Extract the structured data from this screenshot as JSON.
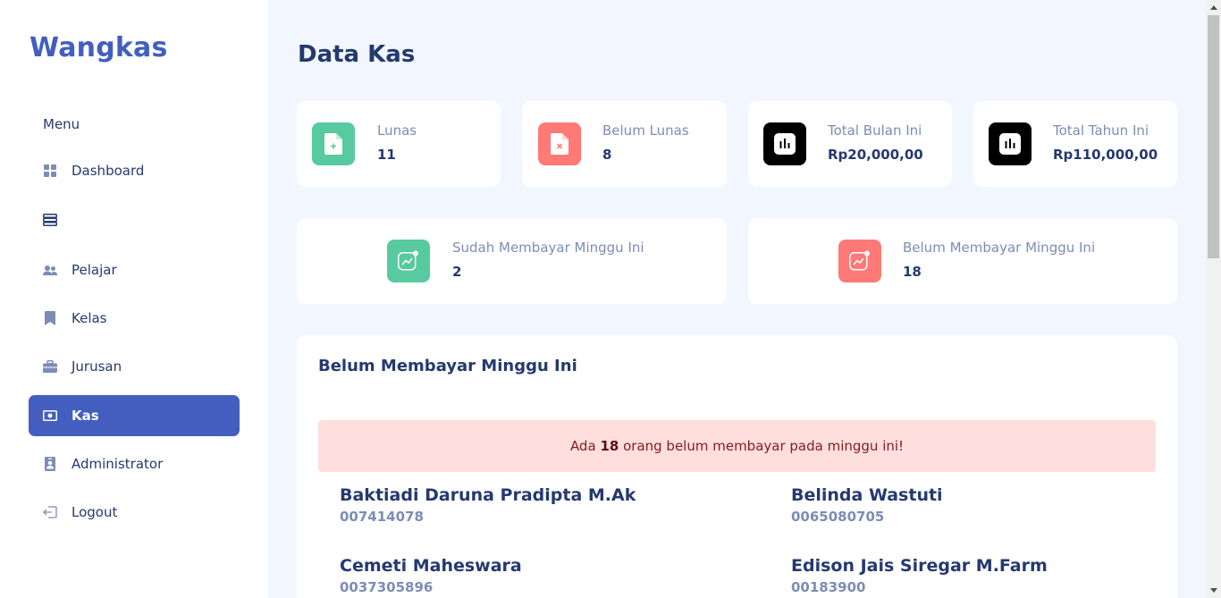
{
  "sidebar": {
    "brand": "Wangkas",
    "menu_title": "Menu",
    "items": [
      {
        "label": "Dashboard",
        "icon": "grid-icon"
      },
      {
        "label": "",
        "icon": "stack-icon"
      },
      {
        "label": "Pelajar",
        "icon": "people-icon"
      },
      {
        "label": "Kelas",
        "icon": "bookmark-icon"
      },
      {
        "label": "Jurusan",
        "icon": "briefcase-icon"
      },
      {
        "label": "Kas",
        "icon": "cash-icon",
        "active": true
      },
      {
        "label": "Administrator",
        "icon": "person-badge-icon"
      },
      {
        "label": "Logout",
        "icon": "logout-icon"
      }
    ]
  },
  "main": {
    "title": "Data Kas",
    "stats": [
      {
        "label": "Lunas",
        "value": "11",
        "color": "#57caa0",
        "icon": "file-plus-icon"
      },
      {
        "label": "Belum Lunas",
        "value": "8",
        "color": "#ff7976",
        "icon": "file-x-icon"
      },
      {
        "label": "Total Bulan Ini",
        "value": "Rp20,000,00",
        "color": "#000000",
        "icon": "bar-chart-icon"
      },
      {
        "label": "Total Tahun Ini",
        "value": "Rp110,000,00",
        "color": "#000000",
        "icon": "bar-chart-icon"
      }
    ],
    "weekly": [
      {
        "label": "Sudah Membayar Minggu Ini",
        "value": "2",
        "color": "#57caa0",
        "icon": "graph-up-icon"
      },
      {
        "label": "Belum Membayar Minggu Ini",
        "value": "18",
        "color": "#ff7976",
        "icon": "graph-up-icon"
      }
    ],
    "list": {
      "title": "Belum Membayar Minggu Ini",
      "alert_prefix": "Ada",
      "alert_count": "18",
      "alert_suffix": "orang belum membayar pada minggu ini!",
      "students": [
        {
          "name": "Baktiadi Daruna Pradipta M.Ak",
          "nis": "007414078"
        },
        {
          "name": "Belinda Wastuti",
          "nis": "0065080705"
        },
        {
          "name": "Cemeti Maheswara",
          "nis": "0037305896"
        },
        {
          "name": "Edison Jais Siregar M.Farm",
          "nis": "00183900"
        }
      ]
    }
  },
  "colors": {
    "accent": "#435ebe",
    "text": "#25396f",
    "muted": "#7c8db5",
    "background": "#f2f7ff"
  }
}
